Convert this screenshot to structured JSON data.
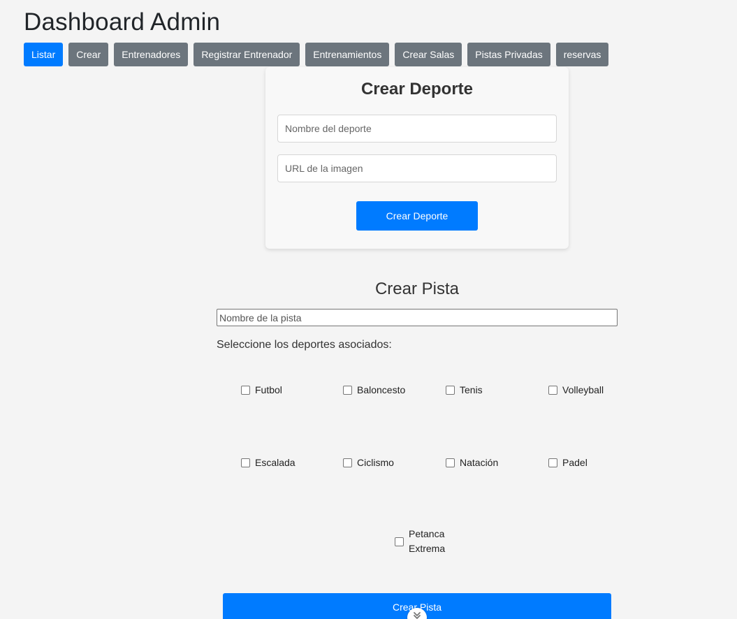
{
  "header": {
    "title": "Dashboard Admin"
  },
  "nav": {
    "items": [
      {
        "label": "Listar",
        "active": true
      },
      {
        "label": "Crear",
        "active": false
      },
      {
        "label": "Entrenadores",
        "active": false
      },
      {
        "label": "Registrar Entrenador",
        "active": false
      },
      {
        "label": "Entrenamientos",
        "active": false
      },
      {
        "label": "Crear Salas",
        "active": false
      },
      {
        "label": "Pistas Privadas",
        "active": false
      },
      {
        "label": "reservas",
        "active": false
      }
    ]
  },
  "crear_deporte": {
    "title": "Crear Deporte",
    "name_placeholder": "Nombre del deporte",
    "url_placeholder": "URL de la imagen",
    "submit_label": "Crear Deporte"
  },
  "crear_pista": {
    "title": "Crear Pista",
    "name_placeholder": "Nombre de la pista",
    "select_label": "Seleccione los deportes asociados:",
    "sports": [
      {
        "label": "Futbol",
        "checked": false
      },
      {
        "label": "Baloncesto",
        "checked": false
      },
      {
        "label": "Tenis",
        "checked": false
      },
      {
        "label": "Volleyball",
        "checked": false
      },
      {
        "label": "Escalada",
        "checked": false
      },
      {
        "label": "Ciclismo",
        "checked": false
      },
      {
        "label": "Natación",
        "checked": false
      },
      {
        "label": "Padel",
        "checked": false
      },
      {
        "label": "Petanca Extrema",
        "checked": false
      }
    ],
    "submit_label": "Crear Pista"
  },
  "colors": {
    "primary": "#007bff",
    "secondary": "#6c757d",
    "background": "#f4f4f4"
  },
  "icons": {
    "scroll": "chevron-down-icon"
  }
}
